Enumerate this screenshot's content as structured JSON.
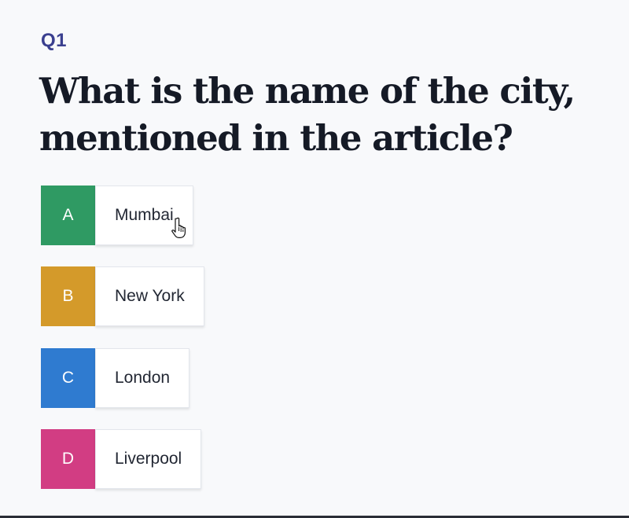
{
  "question": {
    "number": "Q1",
    "text": "What is the name of the city, mentioned in the article?"
  },
  "options": [
    {
      "letter": "A",
      "label": "Mumbai",
      "color": "#2f9a63"
    },
    {
      "letter": "B",
      "label": "New York",
      "color": "#d49a2a"
    },
    {
      "letter": "C",
      "label": "London",
      "color": "#2f7bd0"
    },
    {
      "letter": "D",
      "label": "Liverpool",
      "color": "#d23d83"
    }
  ],
  "cursor": {
    "icon": "hand-pointer-icon"
  }
}
